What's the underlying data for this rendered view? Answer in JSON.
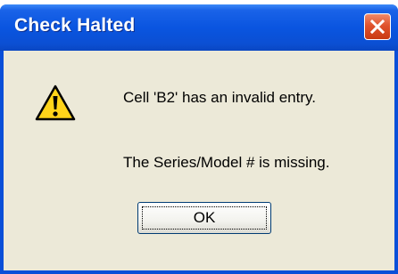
{
  "dialog": {
    "title": "Check Halted",
    "message_line1": "Cell 'B2' has an invalid entry.",
    "message_line2": "The Series/Model # is missing.",
    "ok_label": "OK",
    "icon": "warning-icon",
    "close_icon": "close-icon"
  },
  "colors": {
    "titlebar": "#0a55e0",
    "client_bg": "#ece9d8",
    "close_button": "#e0532d",
    "warning_yellow": "#ffd41a"
  }
}
